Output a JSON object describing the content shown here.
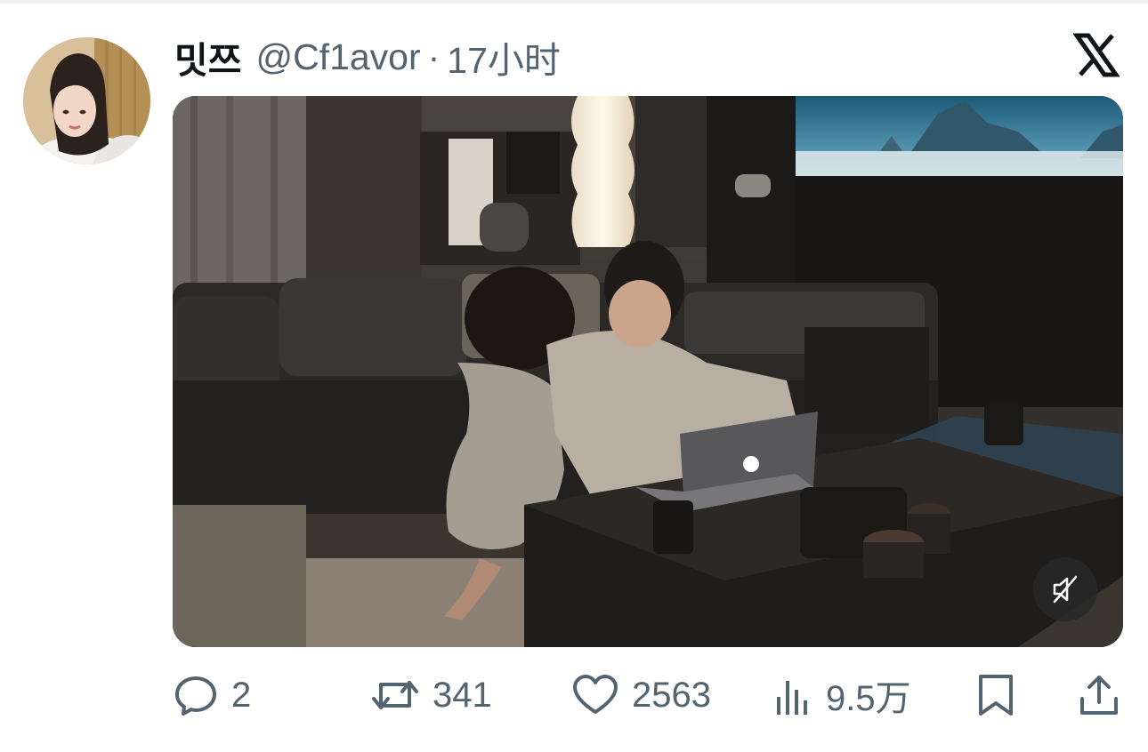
{
  "tweet": {
    "display_name": "밋쯔",
    "handle": "@Cf1avor",
    "separator": "·",
    "time": "17小时"
  },
  "media": {
    "type": "video",
    "muted": true
  },
  "actions": {
    "replies": "2",
    "reposts": "341",
    "likes": "2563",
    "views": "9.5万"
  },
  "icons": {
    "logo": "x-logo-icon",
    "reply": "reply-icon",
    "repost": "repost-icon",
    "like": "heart-icon",
    "views": "views-icon",
    "bookmark": "bookmark-icon",
    "share": "share-icon",
    "mute": "muted-speaker-icon"
  },
  "colors": {
    "text": "#0f1419",
    "secondary": "#536471"
  }
}
